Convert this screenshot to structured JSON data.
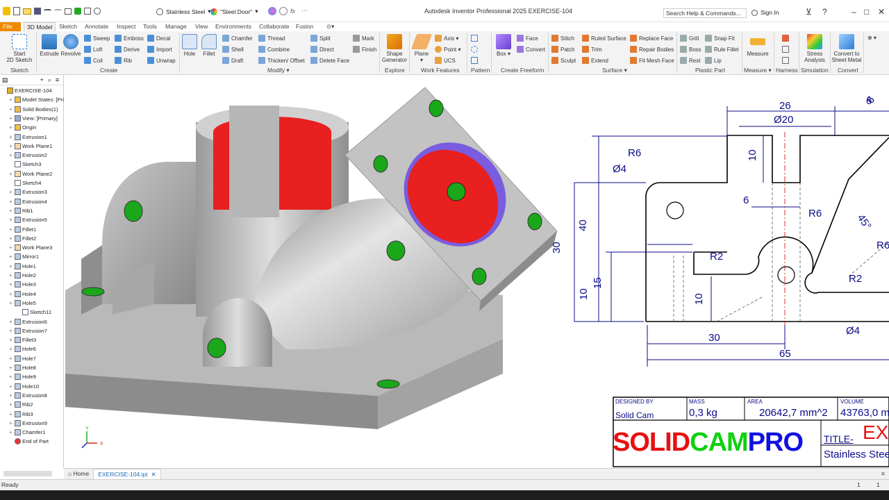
{
  "window": {
    "title": "Autodesk Inventor Professional 2025   EXERCISE-104",
    "search_placeholder": "Search Help & Commands...",
    "signin": "Sign In"
  },
  "quick_access": {
    "material": "Stainless Steel",
    "appearance": "\"Steel Door\""
  },
  "menu_tabs": [
    "File",
    "3D Model",
    "Sketch",
    "Annotate",
    "Inspect",
    "Tools",
    "Manage",
    "View",
    "Environments",
    "Collaborate",
    "Fusion"
  ],
  "active_tab": "3D Model",
  "ribbon": {
    "sketch": {
      "start": "Start\n2D Sketch",
      "group": "Sketch"
    },
    "create": {
      "extrude": "Extrude",
      "revolve": "Revolve",
      "sweep": "Sweep",
      "loft": "Loft",
      "coil": "Coil",
      "emboss": "Emboss",
      "derive": "Derive",
      "rib": "Rib",
      "decal": "Decal",
      "import": "Import",
      "unwrap": "Unwrap",
      "group": "Create"
    },
    "modify": {
      "hole": "Hole",
      "fillet": "Fillet",
      "chamfer": "Chamfer",
      "shell": "Shell",
      "draft": "Draft",
      "thread": "Thread",
      "combine": "Combine",
      "thicken": "Thicken/ Offset",
      "split": "Split",
      "direct": "Direct",
      "delete_face": "Delete Face",
      "mark": "Mark",
      "finish": "Finish",
      "group": "Modify"
    },
    "explore": {
      "shape_generator": "Shape\nGenerator",
      "group": "Explore"
    },
    "work_features": {
      "plane": "Plane",
      "axis": "Axis",
      "point": "Point",
      "ucs": "UCS",
      "group": "Work Features"
    },
    "pattern": {
      "group": "Pattern"
    },
    "freeform": {
      "box": "Box",
      "face": "Face",
      "convert": "Convert",
      "group": "Create Freeform"
    },
    "surface": {
      "stitch": "Stitch",
      "patch": "Patch",
      "sculpt": "Sculpt",
      "ruled": "Ruled Surface",
      "trim": "Trim",
      "extend": "Extend",
      "replace": "Replace Face",
      "repair": "Repair Bodies",
      "fit_mesh": "Fit Mesh Face",
      "group": "Surface"
    },
    "plastic": {
      "grill": "Grill",
      "boss": "Boss",
      "rest": "Rest",
      "snap_fit": "Snap Fit",
      "rule_fillet": "Rule Fillet",
      "lip": "Lip",
      "group": "Plastic Part"
    },
    "measure": {
      "measure": "Measure",
      "group": "Measure"
    },
    "harness": {
      "group": "Harness"
    },
    "simulation": {
      "stress": "Stress\nAnalysis",
      "group": "Simulation"
    },
    "convert": {
      "sheet": "Convert to\nSheet Metal",
      "group": "Convert"
    }
  },
  "browser": {
    "nodes": [
      {
        "label": "EXERCISE-104",
        "depth": 0,
        "icon": "part-icon"
      },
      {
        "label": "Model States: [Primar",
        "depth": 1,
        "icon": "folder-icon"
      },
      {
        "label": "Solid Bodies(1)",
        "depth": 1,
        "icon": "folder-icon"
      },
      {
        "label": "View: [Primary]",
        "depth": 1,
        "icon": "view-icon"
      },
      {
        "label": "Origin",
        "depth": 1,
        "icon": "folder-icon"
      },
      {
        "label": "Extrusion1",
        "depth": 1,
        "icon": "extrude-icon"
      },
      {
        "label": "Work Plane1",
        "depth": 1,
        "icon": "plane-icon"
      },
      {
        "label": "Extrusion2",
        "depth": 1,
        "icon": "extrude-icon"
      },
      {
        "label": "Sketch3",
        "depth": 1,
        "icon": "sketch-icon"
      },
      {
        "label": "Work Plane2",
        "depth": 1,
        "icon": "plane-icon"
      },
      {
        "label": "Sketch4",
        "depth": 1,
        "icon": "sketch-icon"
      },
      {
        "label": "Extrusion3",
        "depth": 1,
        "icon": "extrude-icon"
      },
      {
        "label": "Extrusion4",
        "depth": 1,
        "icon": "extrude-icon"
      },
      {
        "label": "Rib1",
        "depth": 1,
        "icon": "rib-icon"
      },
      {
        "label": "Extrusion5",
        "depth": 1,
        "icon": "extrude-icon"
      },
      {
        "label": "Fillet1",
        "depth": 1,
        "icon": "fillet-icon"
      },
      {
        "label": "Fillet2",
        "depth": 1,
        "icon": "fillet-icon"
      },
      {
        "label": "Work Plane3",
        "depth": 1,
        "icon": "plane-icon"
      },
      {
        "label": "Mirror1",
        "depth": 1,
        "icon": "mirror-icon"
      },
      {
        "label": "Hole1",
        "depth": 1,
        "icon": "hole-icon"
      },
      {
        "label": "Hole2",
        "depth": 1,
        "icon": "hole-icon"
      },
      {
        "label": "Hole3",
        "depth": 1,
        "icon": "hole-icon"
      },
      {
        "label": "Hole4",
        "depth": 1,
        "icon": "hole-icon"
      },
      {
        "label": "Hole5",
        "depth": 1,
        "icon": "hole-icon"
      },
      {
        "label": "Sketch11",
        "depth": 2,
        "icon": "sketch-icon"
      },
      {
        "label": "Extrusion6",
        "depth": 1,
        "icon": "extrude-icon"
      },
      {
        "label": "Extrusion7",
        "depth": 1,
        "icon": "extrude-icon"
      },
      {
        "label": "Fillet3",
        "depth": 1,
        "icon": "fillet-icon"
      },
      {
        "label": "Hole6",
        "depth": 1,
        "icon": "hole-icon"
      },
      {
        "label": "Hole7",
        "depth": 1,
        "icon": "hole-icon"
      },
      {
        "label": "Hole8",
        "depth": 1,
        "icon": "hole-icon"
      },
      {
        "label": "Hole9",
        "depth": 1,
        "icon": "hole-icon"
      },
      {
        "label": "Hole10",
        "depth": 1,
        "icon": "hole-icon"
      },
      {
        "label": "Extrusion8",
        "depth": 1,
        "icon": "extrude-icon"
      },
      {
        "label": "Rib2",
        "depth": 1,
        "icon": "rib-icon"
      },
      {
        "label": "Rib3",
        "depth": 1,
        "icon": "rib-icon"
      },
      {
        "label": "Extrusion9",
        "depth": 1,
        "icon": "extrude-icon"
      },
      {
        "label": "Chamfer1",
        "depth": 1,
        "icon": "chamfer-icon"
      },
      {
        "label": "End of Part",
        "depth": 1,
        "icon": "end-of-part-icon"
      }
    ]
  },
  "drawing": {
    "dims": [
      "26",
      "Ø20",
      "6",
      "10",
      "R6",
      "Ø4",
      "6",
      "R6",
      "45°",
      "40",
      "30",
      "15",
      "10",
      "R2",
      "R2",
      "10",
      "30",
      "65",
      "Ø4",
      "R6",
      "6"
    ]
  },
  "titleblock": {
    "designed_by_label": "DESIGNED BY",
    "designed_by": "Solid Cam",
    "mass_label": "MASS",
    "mass": "0,3 kg",
    "area_label": "AREA",
    "area": "20642,7 mm^2",
    "volume_label": "VOLUME",
    "volume": "43763,0 m",
    "logo_a": "SOLID",
    "logo_b": "CAM",
    "logo_c": "PRO",
    "title_label": "TITLE-",
    "title": "EX",
    "material": "Stainless Stee"
  },
  "doc_tabs": {
    "home": "Home",
    "file": "EXERCISE-104.ipt"
  },
  "status": {
    "text": "Ready",
    "page_a": "1",
    "page_b": "1"
  },
  "colors": {
    "accent": "#f08a00",
    "dim": "#0a0a8a",
    "hole_green": "#1aa81a",
    "bore_red": "#e82020"
  }
}
